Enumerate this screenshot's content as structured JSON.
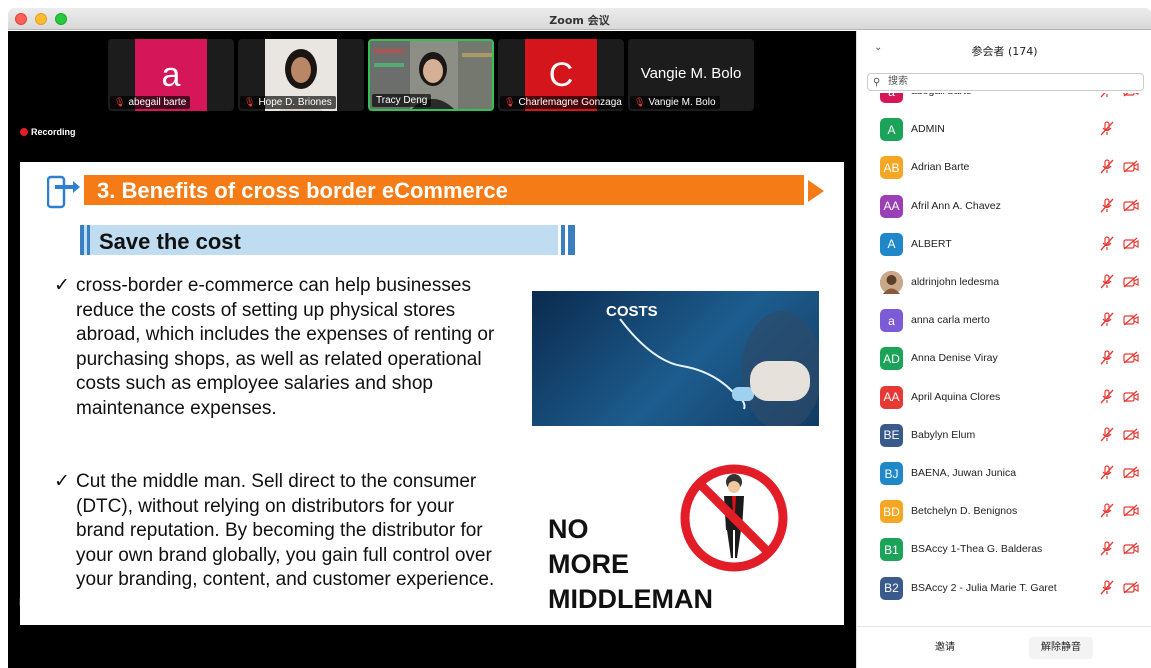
{
  "window": {
    "title": "Zoom 会议"
  },
  "video_strip": {
    "tiles": [
      {
        "name": "abegail barte",
        "avatar_letter": "a",
        "avatar_color": "#d5175a",
        "muted": true
      },
      {
        "name": "Hope D. Briones",
        "muted": true,
        "video": true
      },
      {
        "name": "Tracy Deng",
        "muted": false,
        "video": true,
        "active": true
      },
      {
        "name": "Charlemagne Gonzaga",
        "avatar_letter": "C",
        "avatar_color": "#d4161c",
        "muted": true
      },
      {
        "name": "Vangie M. Bolo",
        "big_name": "Vangie M. Bolo",
        "muted": true
      }
    ],
    "next_icon": "chevron-right-icon"
  },
  "recording": {
    "label": "Recording"
  },
  "slide": {
    "title": "3. Benefits of cross border eCommerce",
    "subtitle": "Save the cost",
    "bullets": [
      "cross-border e-commerce can help businesses reduce the costs of setting up physical stores abroad, which includes the expenses of renting or purchasing shops, as well as related operational costs such as employee salaries and shop maintenance expenses.",
      "Cut the middle man. Sell direct to the consumer (DTC), without relying on distributors for your brand reputation. By becoming the distributor for your own brand globally, you gain full control over your branding, content, and customer experience."
    ],
    "check_glyph": "✓",
    "image_costs_label": "COSTS",
    "nomore_text": "NO\nMORE\nMIDDLEMAN"
  },
  "participants": {
    "title": "参会者 (174)",
    "search_placeholder": "搜索",
    "list": [
      {
        "initials": "a",
        "name": "abegail barte",
        "color": "#d5175a",
        "cam": true
      },
      {
        "initials": "A",
        "name": "ADMIN",
        "color": "#1ca35a",
        "cam": false
      },
      {
        "initials": "AB",
        "name": "Adrian Barte",
        "color": "#f5a623",
        "cam": true
      },
      {
        "initials": "AA",
        "name": "Afril Ann A. Chavez",
        "color": "#9b3fb5",
        "cam": true
      },
      {
        "initials": "A",
        "name": "ALBERT",
        "color": "#1e88c9",
        "cam": true
      },
      {
        "initials": "",
        "name": "aldrinjohn ledesma",
        "color": "#b07a5a",
        "photo": true,
        "cam": true
      },
      {
        "initials": "a",
        "name": "anna carla merto",
        "color": "#7b5bd6",
        "cam": true
      },
      {
        "initials": "AD",
        "name": "Anna Denise Viray",
        "color": "#1ca35a",
        "cam": true
      },
      {
        "initials": "AA",
        "name": "April Aquina Clores",
        "color": "#e53935",
        "cam": true
      },
      {
        "initials": "BE",
        "name": "Babylyn Elum",
        "color": "#3a5a8c",
        "cam": true
      },
      {
        "initials": "BJ",
        "name": "BAENA, Juwan Junica",
        "color": "#1e88c9",
        "cam": true
      },
      {
        "initials": "BD",
        "name": "Betchelyn D. Benignos",
        "color": "#f5a623",
        "cam": true
      },
      {
        "initials": "B1",
        "name": "BSAccy 1-Thea G. Balderas",
        "color": "#1ca35a",
        "cam": true
      },
      {
        "initials": "B2",
        "name": "BSAccy 2 - Julia Marie T. Garet",
        "color": "#3a5a8c",
        "cam": true
      }
    ],
    "footer": {
      "invite": "邀请",
      "unmute": "解除静音"
    }
  }
}
